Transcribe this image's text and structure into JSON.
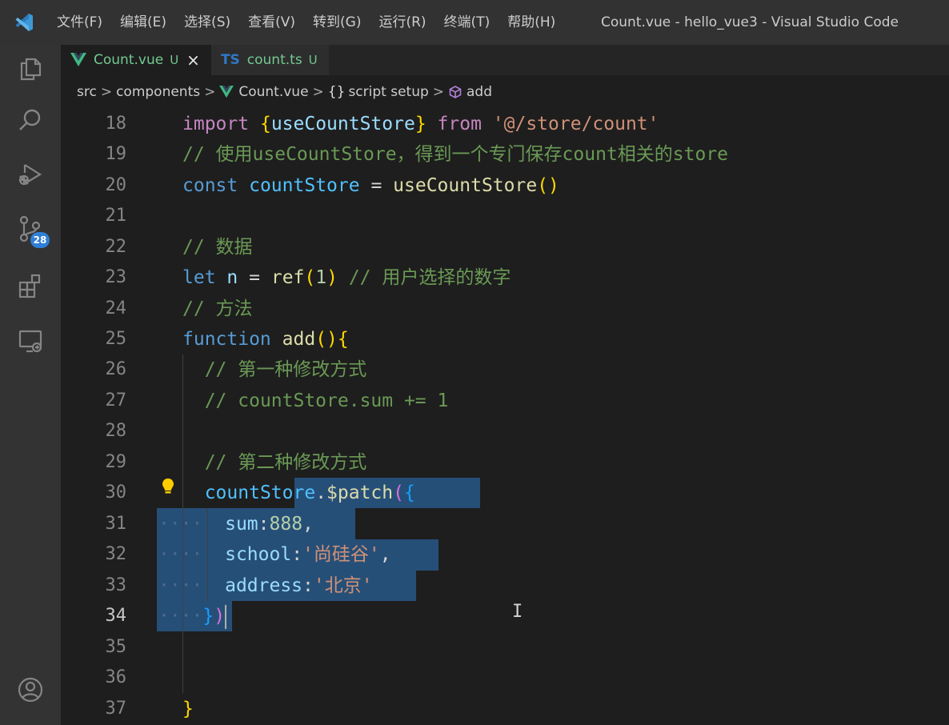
{
  "menu": {
    "items": [
      "文件(F)",
      "编辑(E)",
      "选择(S)",
      "查看(V)",
      "转到(G)",
      "运行(R)",
      "终端(T)",
      "帮助(H)"
    ]
  },
  "window": {
    "title": "Count.vue - hello_vue3 - Visual Studio Code"
  },
  "activity_bar": {
    "icons": [
      "explorer-icon",
      "search-icon",
      "run-debug-icon",
      "source-control-icon",
      "extensions-icon",
      "remote-explorer-icon",
      "account-icon"
    ],
    "source_control_badge": "28"
  },
  "tabs": [
    {
      "label": "Count.vue",
      "status": "U",
      "close": "×",
      "lang": "vue",
      "active": true
    },
    {
      "label": "count.ts",
      "status": "U",
      "lang_label": "TS",
      "active": false
    }
  ],
  "breadcrumbs": {
    "items": [
      "src",
      "components",
      "Count.vue",
      "script setup",
      "add"
    ],
    "separator": ">",
    "braces": "{}"
  },
  "editor": {
    "line_numbers": [
      "18",
      "19",
      "20",
      "21",
      "22",
      "23",
      "24",
      "25",
      "26",
      "27",
      "28",
      "29",
      "30",
      "31",
      "32",
      "33",
      "34",
      "35",
      "36",
      "37"
    ],
    "current_line": "34",
    "code": {
      "l18": {
        "kw": "import",
        "b1": "{",
        "name": "useCountStore",
        "b2": "}",
        "from": "from",
        "path": "'@/store/count'"
      },
      "l19": {
        "comment": "// 使用useCountStore，得到一个专门保存count相关的store"
      },
      "l20": {
        "kw": "const",
        "name": "countStore",
        "eq": "=",
        "fn": "useCountStore",
        "parens": "()"
      },
      "l22": {
        "comment": "// 数据"
      },
      "l23": {
        "kw": "let",
        "name": "n",
        "eq": "=",
        "fn": "ref",
        "po": "(",
        "num": "1",
        "pc": ")",
        "comment": "// 用户选择的数字"
      },
      "l24": {
        "comment": "// 方法"
      },
      "l25": {
        "kw": "function",
        "fn": "add",
        "parens": "()",
        "brace": "{"
      },
      "l26": {
        "comment": "// 第一种修改方式"
      },
      "l27": {
        "comment": "// countStore.sum += 1"
      },
      "l29": {
        "comment": "// 第二种修改方式"
      },
      "l30": {
        "obj": "countSto",
        "obj2": "re",
        "dot": ".",
        "fn": "$patch",
        "po": "(",
        "bo": "{"
      },
      "l31": {
        "key": "sum",
        "colon": ":",
        "num": "888",
        "comma": ","
      },
      "l32": {
        "key": "school",
        "colon": ":",
        "str": "'尚硅谷'",
        "comma": ","
      },
      "l33": {
        "key": "address",
        "colon": ":",
        "str": "'北京'"
      },
      "l34": {
        "bc": "}",
        "pc": ")"
      },
      "l37": {
        "brace": "}"
      }
    },
    "whitespace_dots": "····"
  }
}
